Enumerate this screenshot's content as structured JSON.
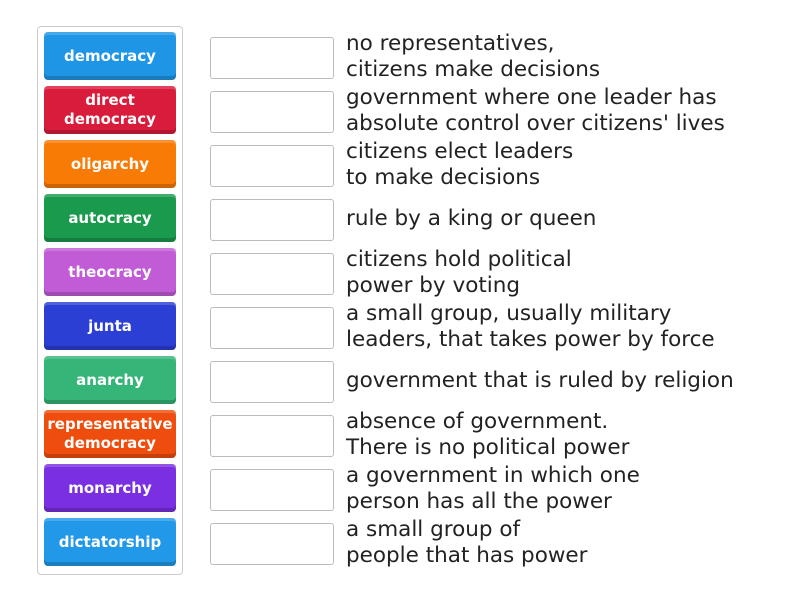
{
  "tiles": [
    {
      "label": "democracy",
      "color": "#1f95e6"
    },
    {
      "label": "direct democracy",
      "color": "#d91c3b"
    },
    {
      "label": "oligarchy",
      "color": "#f87b05"
    },
    {
      "label": "autocracy",
      "color": "#1a9a4c"
    },
    {
      "label": "theocracy",
      "color": "#c25cd6"
    },
    {
      "label": "junta",
      "color": "#2b3fd4"
    },
    {
      "label": "anarchy",
      "color": "#35b577"
    },
    {
      "label": "representative democracy",
      "color": "#ee4d0e"
    },
    {
      "label": "monarchy",
      "color": "#7a2fe0"
    },
    {
      "label": "dictatorship",
      "color": "#2299e8"
    }
  ],
  "definitions": [
    "no representatives,\ncitizens make decisions",
    "government where one leader has\nabsolute control over citizens' lives",
    "citizens elect leaders\nto make decisions",
    "rule by a king or queen",
    "citizens hold political\npower by voting",
    "a small group, usually military\nleaders, that takes power by force",
    "government that is ruled by religion",
    "absence of government.\nThere is no political power",
    "a government in which one\nperson has all the power",
    "a small group of\npeople that has power"
  ]
}
